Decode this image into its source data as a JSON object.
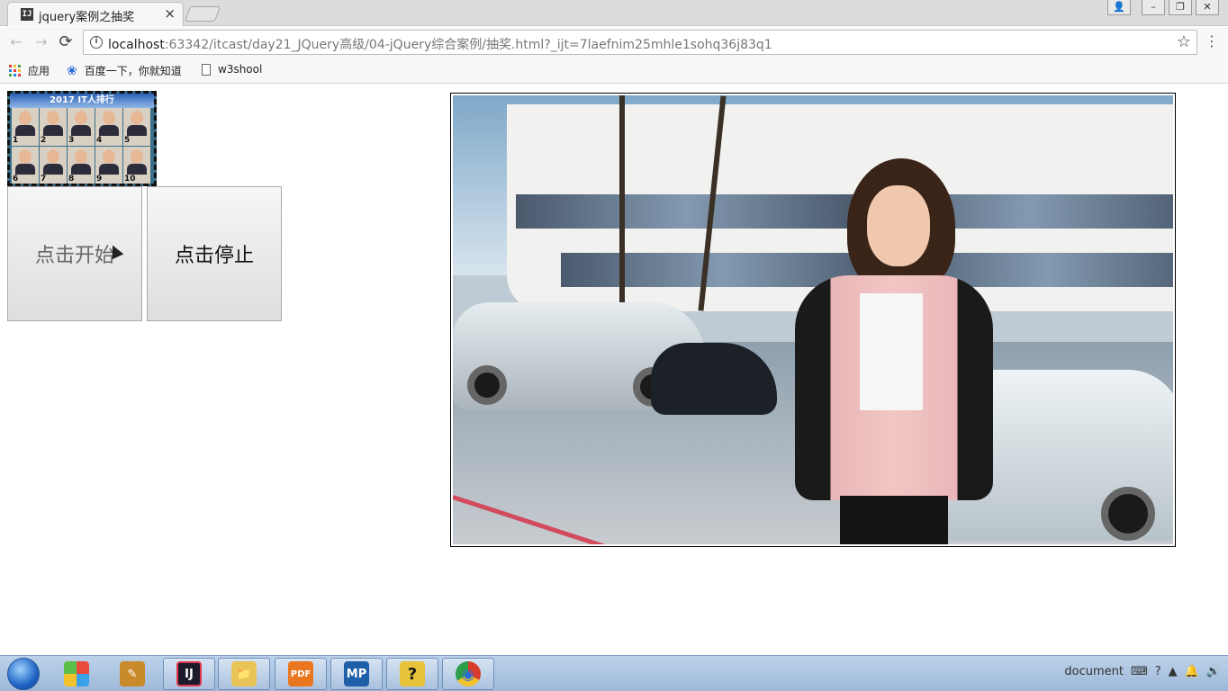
{
  "browser": {
    "tab_title": "jquery案例之抽奖",
    "tab_favicon_text": "IJ",
    "tab_close": "×",
    "window_controls": {
      "user": "👤",
      "minimize": "–",
      "restore": "❐",
      "close": "✕"
    },
    "nav": {
      "back": "←",
      "forward": "→",
      "reload": "⟳"
    },
    "url_host": "localhost",
    "url_rest": ":63342/itcast/day21_JQuery高级/04-jQuery综合案例/抽奖.html?_ijt=7laefnim25mhle1sohq36j83q1",
    "info_icon": "i",
    "star": "☆",
    "menu": "⋮",
    "bookmarks": [
      {
        "label": "应用",
        "icon": "apps-icon"
      },
      {
        "label": "百度一下，你就知道",
        "icon": "baidu-paw-icon"
      },
      {
        "label": "w3shool",
        "icon": "page-icon"
      }
    ]
  },
  "page": {
    "thumb_banner": "2017 IT人排行",
    "faces": [
      {
        "rank": "1"
      },
      {
        "rank": "2"
      },
      {
        "rank": "3"
      },
      {
        "rank": "4"
      },
      {
        "rank": "5"
      },
      {
        "rank": "6"
      },
      {
        "rank": "7"
      },
      {
        "rank": "8"
      },
      {
        "rank": "9"
      },
      {
        "rank": "10"
      }
    ],
    "start_button": "点击开始",
    "stop_button": "点击停止"
  },
  "taskbar": {
    "apps": [
      {
        "name": "colorful-logo-app",
        "label": "",
        "color": "#e84a3c"
      },
      {
        "name": "pencils-app",
        "label": "✎",
        "color": "#c98a2b"
      },
      {
        "name": "intellij-app",
        "label": "IJ",
        "color": "#1b1b2a"
      },
      {
        "name": "file-explorer-app",
        "label": "📁",
        "color": "#e8c458"
      },
      {
        "name": "pdf-app",
        "label": "PDF",
        "color": "#e8771f"
      },
      {
        "name": "mp-app",
        "label": "MP",
        "color": "#1f5fa8"
      },
      {
        "name": "help-app",
        "label": "?",
        "color": "#e6c33a"
      },
      {
        "name": "chrome-app",
        "label": "◉",
        "color": "#d93b2b"
      }
    ],
    "tray_text": "document",
    "tray_icons": [
      "⌨",
      "?",
      "▲",
      "🔔",
      "🔊"
    ]
  }
}
